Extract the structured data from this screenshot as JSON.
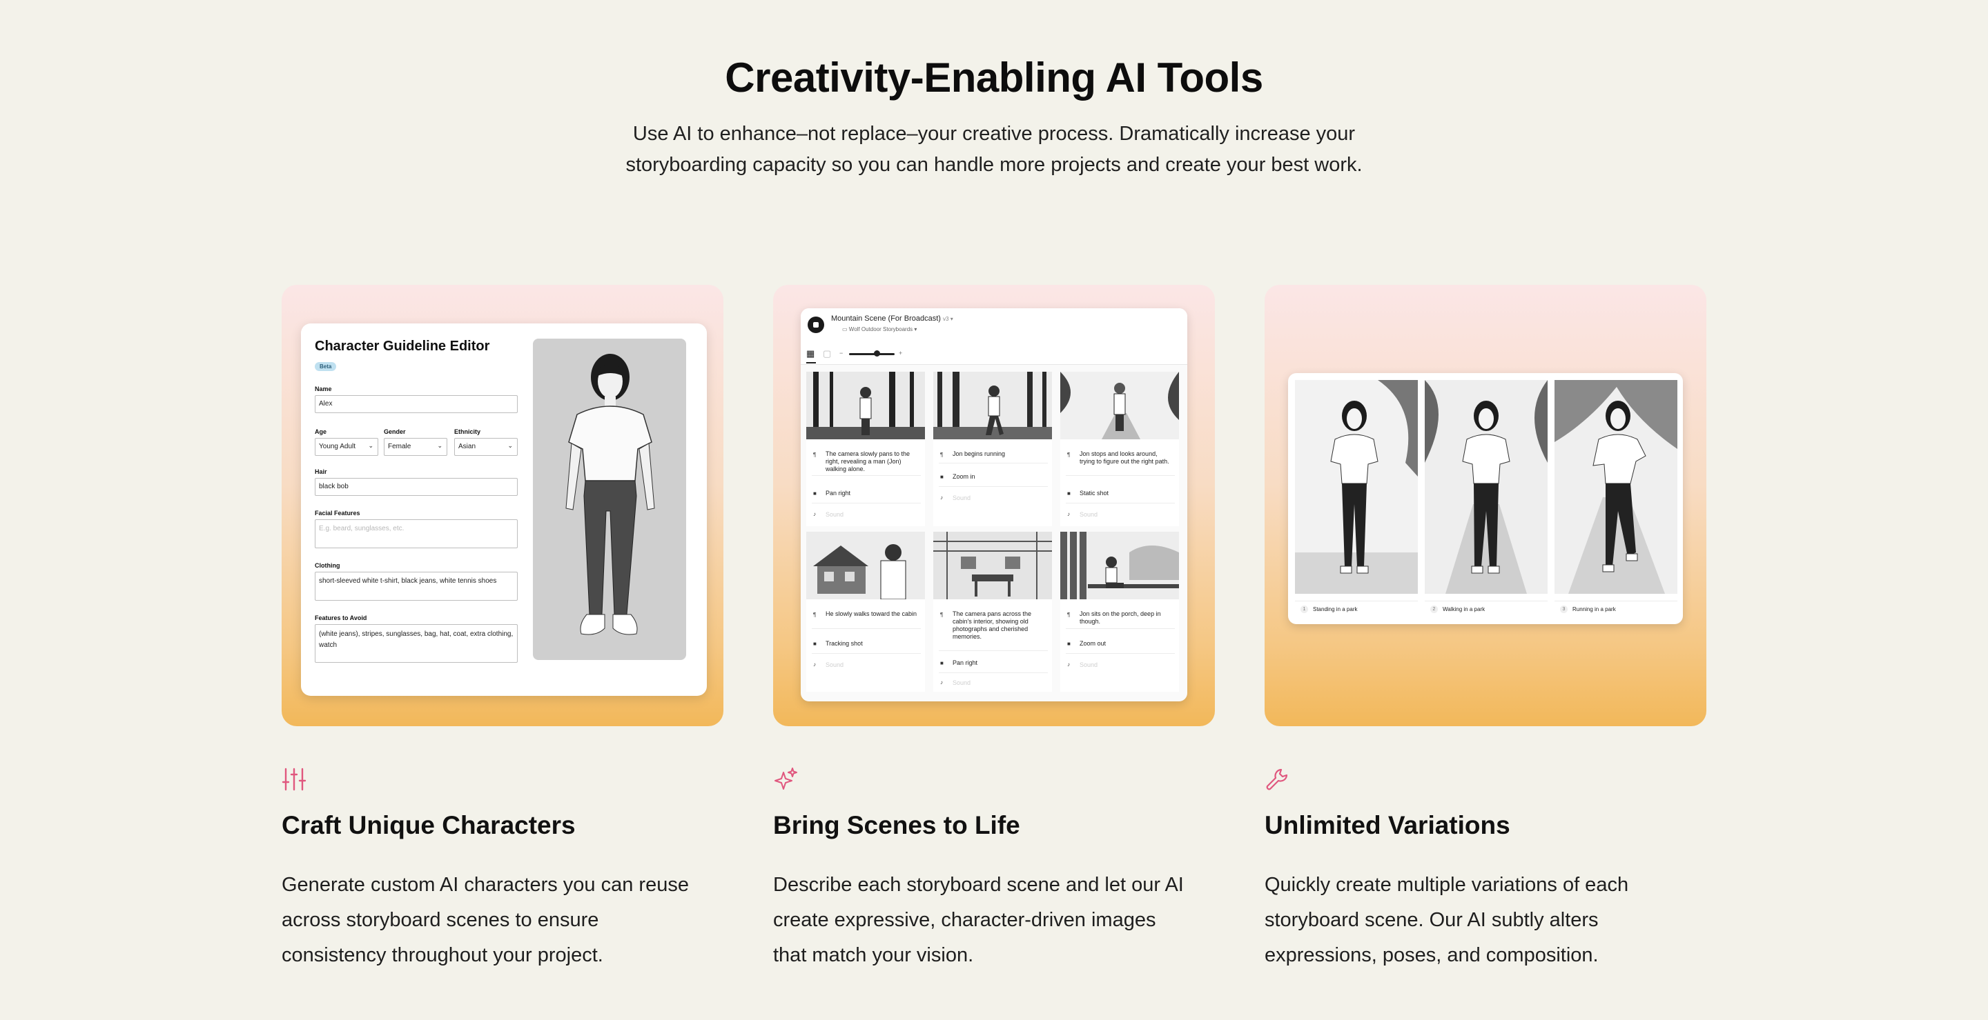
{
  "header": {
    "title": "Creativity-Enabling AI Tools",
    "subtitle_line1": "Use AI to enhance–not replace–your creative process. Dramatically increase your",
    "subtitle_line2": "storyboarding capacity so you can handle more projects and create your best work."
  },
  "colors": {
    "background": "#f3f2ea",
    "accent_icon": "#e0577e",
    "card_gradient_top": "#fbe6e6",
    "card_gradient_bottom": "#f2b85a"
  },
  "features": [
    {
      "icon": "sliders-icon",
      "title": "Craft Unique Characters",
      "desc_lines": [
        "Generate custom AI characters you can reuse",
        "across storyboard scenes to ensure",
        "consistency throughout your project."
      ]
    },
    {
      "icon": "sparkles-icon",
      "title": "Bring Scenes to Life",
      "desc_lines": [
        "Describe each storyboard scene and let our AI",
        "create expressive, character-driven images",
        "that match your vision."
      ]
    },
    {
      "icon": "wrench-icon",
      "title": "Unlimited Variations",
      "desc_lines": [
        "Quickly create multiple variations of each",
        "storyboard scene. Our AI subtly alters",
        "expressions, poses, and composition."
      ]
    }
  ],
  "editor": {
    "title": "Character Guideline Editor",
    "badge": "Beta",
    "name_label": "Name",
    "name_value": "Alex",
    "age_label": "Age",
    "age_value": "Young Adult",
    "gender_label": "Gender",
    "gender_value": "Female",
    "ethnicity_label": "Ethnicity",
    "ethnicity_value": "Asian",
    "hair_label": "Hair",
    "hair_value": "black bob",
    "facial_label": "Facial Features",
    "facial_placeholder": "E.g. beard, sunglasses, etc.",
    "clothing_label": "Clothing",
    "clothing_value": "short-sleeved white t-shirt, black jeans, white tennis shoes",
    "avoid_label": "Features to Avoid",
    "avoid_value": "(white jeans), stripes, sunglasses, bag, hat, coat, extra clothing, watch"
  },
  "storyboard": {
    "title": "Mountain Scene (For Broadcast)",
    "title_suffix": "v3 ▾",
    "folder": "Wolf Outdoor Storyboards ▾",
    "frames": [
      {
        "desc": "The camera slowly pans to the right, revealing a man (Jon) walking alone.",
        "shot": "Pan right",
        "sound": "Sound"
      },
      {
        "desc": "Jon begins running",
        "shot": "Zoom in",
        "sound": "Sound"
      },
      {
        "desc": "Jon stops and looks around, trying to figure out the right path.",
        "shot": "Static shot",
        "sound": "Sound"
      },
      {
        "desc": "He slowly walks toward the cabin",
        "shot": "Tracking shot",
        "sound": "Sound"
      },
      {
        "desc": "The camera pans across the cabin's interior, showing old photographs and cherished memories.",
        "shot": "Pan right",
        "sound": "Sound"
      },
      {
        "desc": "Jon sits on the porch, deep in though.",
        "shot": "Zoom out",
        "sound": "Sound"
      }
    ]
  },
  "variations": {
    "items": [
      {
        "num": "1",
        "caption": "Standing in a park"
      },
      {
        "num": "2",
        "caption": "Walking in a park"
      },
      {
        "num": "3",
        "caption": "Running in a park"
      }
    ]
  }
}
